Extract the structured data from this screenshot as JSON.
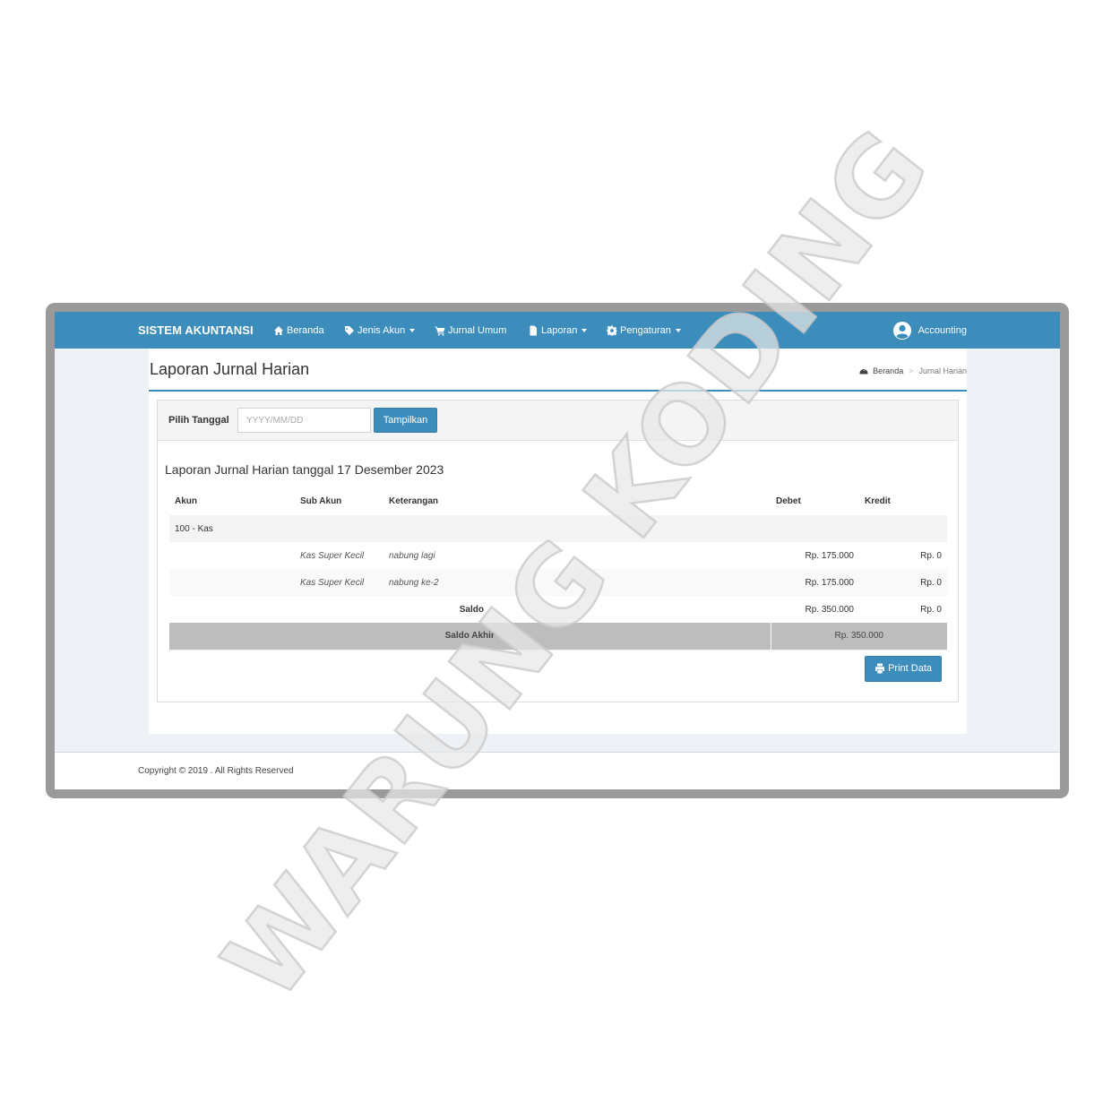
{
  "navbar": {
    "brand": "SISTEM AKUNTANSI",
    "items": [
      {
        "label": "Beranda",
        "icon": "home-icon",
        "dropdown": false
      },
      {
        "label": "Jenis Akun",
        "icon": "tag-icon",
        "dropdown": true
      },
      {
        "label": "Jurnal Umum",
        "icon": "cart-icon",
        "dropdown": false
      },
      {
        "label": "Laporan",
        "icon": "file-icon",
        "dropdown": true
      },
      {
        "label": "Pengaturan",
        "icon": "gear-icon",
        "dropdown": true
      }
    ],
    "user": "Accounting"
  },
  "page": {
    "title": "Laporan Jurnal Harian",
    "breadcrumb": [
      "Beranda",
      "Jurnal Harian"
    ]
  },
  "filter": {
    "label": "Pilih Tanggal",
    "placeholder": "YYYY/MM/DD",
    "button": "Tampilkan"
  },
  "report": {
    "title": "Laporan Jurnal Harian tanggal 17 Desember 2023",
    "columns": [
      "Akun",
      "Sub Akun",
      "Keterangan",
      "Debet",
      "Kredit"
    ],
    "account": "100 - Kas",
    "rows": [
      {
        "sub_akun": "Kas Super Kecil",
        "keterangan": "nabung lagi",
        "debet": "Rp. 175.000",
        "kredit": "Rp. 0"
      },
      {
        "sub_akun": "Kas Super Kecil",
        "keterangan": "nabung ke-2",
        "debet": "Rp. 175.000",
        "kredit": "Rp. 0"
      }
    ],
    "saldo": {
      "label": "Saldo",
      "debet": "Rp. 350.000",
      "kredit": "Rp. 0"
    },
    "saldo_akhir": {
      "label": "Saldo Akhir",
      "value": "Rp. 350.000"
    },
    "print_button": "Print Data"
  },
  "footer": {
    "copyright": "Copyright © 2019 . All Rights Reserved"
  },
  "watermark": {
    "text": "WARUNG KODING"
  },
  "colors": {
    "primary": "#3c8dbc",
    "content_bg": "#eef1f5",
    "frame": "#9a9a9a",
    "total_row": "#bdbdbd"
  }
}
